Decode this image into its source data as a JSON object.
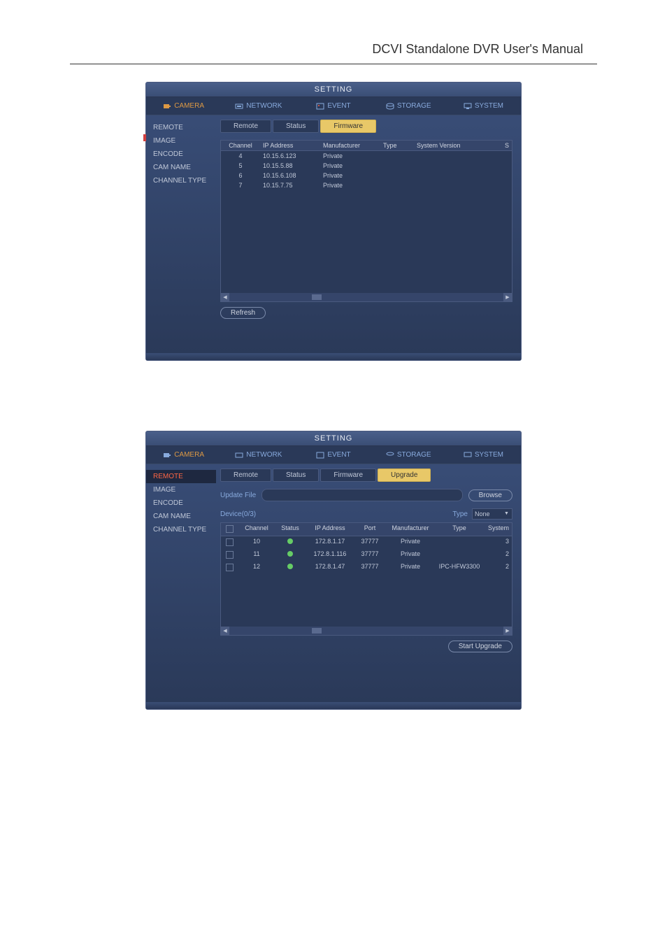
{
  "doc_title": "DCVI Standalone DVR User's Manual",
  "window_title": "SETTING",
  "topnav": [
    {
      "label": "CAMERA"
    },
    {
      "label": "NETWORK"
    },
    {
      "label": "EVENT"
    },
    {
      "label": "STORAGE"
    },
    {
      "label": "SYSTEM"
    }
  ],
  "sidebar": [
    "REMOTE",
    "IMAGE",
    "ENCODE",
    "CAM NAME",
    "CHANNEL TYPE"
  ],
  "s1": {
    "tabs": [
      "Remote",
      "Status",
      "Firmware"
    ],
    "active_tab": "Firmware",
    "headers": [
      "Channel",
      "IP Address",
      "Manufacturer",
      "Type",
      "System Version",
      "S"
    ],
    "rows": [
      {
        "channel": "4",
        "ip": "10.15.6.123",
        "manufacturer": "Private",
        "type": "",
        "sv": ""
      },
      {
        "channel": "5",
        "ip": "10.15.5.88",
        "manufacturer": "Private",
        "type": "",
        "sv": ""
      },
      {
        "channel": "6",
        "ip": "10.15.6.108",
        "manufacturer": "Private",
        "type": "",
        "sv": ""
      },
      {
        "channel": "7",
        "ip": "10.15.7.75",
        "manufacturer": "Private",
        "type": "",
        "sv": ""
      }
    ],
    "refresh_label": "Refresh"
  },
  "s2": {
    "tabs": [
      "Remote",
      "Status",
      "Firmware",
      "Upgrade"
    ],
    "active_tab": "Upgrade",
    "sidebar_active": "REMOTE",
    "update_file_label": "Update File",
    "browse_label": "Browse",
    "device_label": "Device(0/3)",
    "type_label": "Type",
    "type_value": "None",
    "headers": [
      "Channel",
      "Status",
      "IP Address",
      "Port",
      "Manufacturer",
      "Type",
      "System"
    ],
    "rows": [
      {
        "channel": "10",
        "ip": "172.8.1.17",
        "port": "37777",
        "manufacturer": "Private",
        "type": "",
        "system": "3"
      },
      {
        "channel": "11",
        "ip": "172.8.1.116",
        "port": "37777",
        "manufacturer": "Private",
        "type": "",
        "system": "2"
      },
      {
        "channel": "12",
        "ip": "172.8.1.47",
        "port": "37777",
        "manufacturer": "Private",
        "type": "IPC-HFW3300",
        "system": "2"
      }
    ],
    "start_upgrade_label": "Start Upgrade"
  }
}
